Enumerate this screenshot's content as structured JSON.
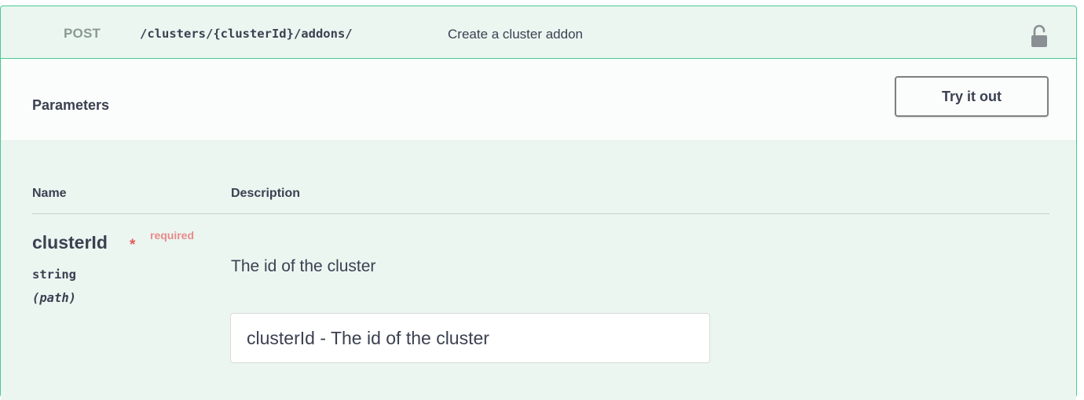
{
  "operation": {
    "method": "POST",
    "path": "/clusters/{clusterId}/addons/",
    "summary": "Create a cluster addon",
    "lock_icon": "unlocked-padlock-icon",
    "accent_color": "#49cc90"
  },
  "parameters_section": {
    "title": "Parameters",
    "try_it_out_label": "Try it out",
    "columns": {
      "name": "Name",
      "description": "Description"
    },
    "items": [
      {
        "name": "clusterId",
        "required_marker": "*",
        "required_label": "required",
        "type": "string",
        "in": "(path)",
        "description": "The id of the cluster",
        "input_value": "",
        "input_placeholder": "clusterId - The id of the cluster"
      }
    ]
  }
}
